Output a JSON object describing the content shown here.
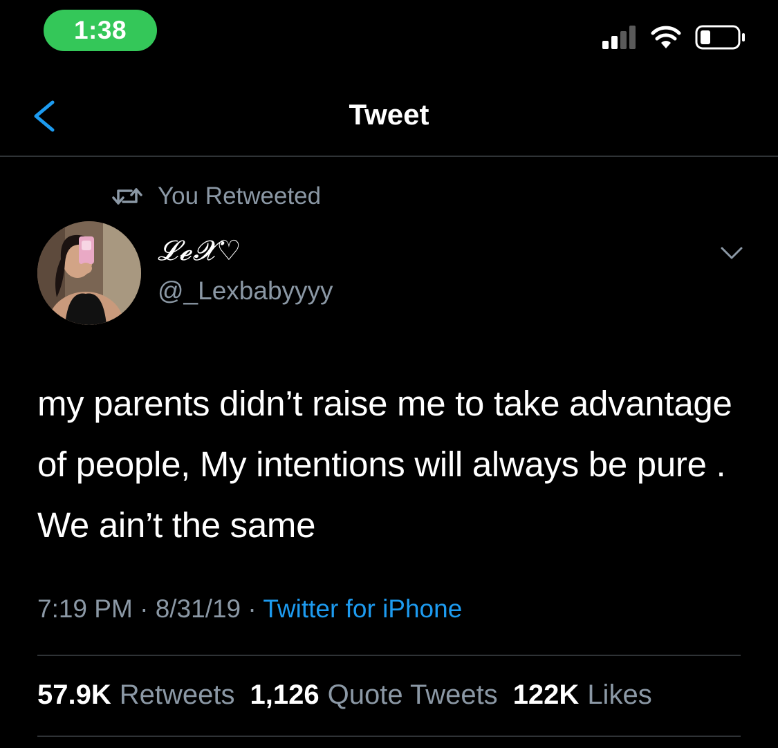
{
  "status_bar": {
    "time": "1:38",
    "icons": [
      "cellular-signal-icon",
      "wifi-icon",
      "battery-icon"
    ],
    "time_pill_color": "#34c759"
  },
  "nav": {
    "back_icon": "chevron-left-icon",
    "title": "Tweet"
  },
  "retweet_context": {
    "icon": "retweet-icon",
    "label": "You Retweeted"
  },
  "tweet": {
    "author": {
      "display_name": "𝓛𝓮𝓧♡",
      "handle": "@_Lexbabyyyy"
    },
    "menu_icon": "chevron-down-icon",
    "text": "my parents didn’t raise me to take advantage of people, My intentions will always be pure . We ain’t the same",
    "time": "7:19 PM",
    "date": "8/31/19",
    "separator": "·",
    "source": "Twitter for iPhone",
    "stats": [
      {
        "count": "57.9K",
        "label": "Retweets"
      },
      {
        "count": "1,126",
        "label": "Quote Tweets"
      },
      {
        "count": "122K",
        "label": "Likes"
      }
    ]
  },
  "colors": {
    "background": "#000000",
    "primary_text": "#ffffff",
    "secondary_text": "#8b98a5",
    "link": "#1d9bf0",
    "divider": "#2f3336",
    "back_icon": "#1d9bf0"
  }
}
